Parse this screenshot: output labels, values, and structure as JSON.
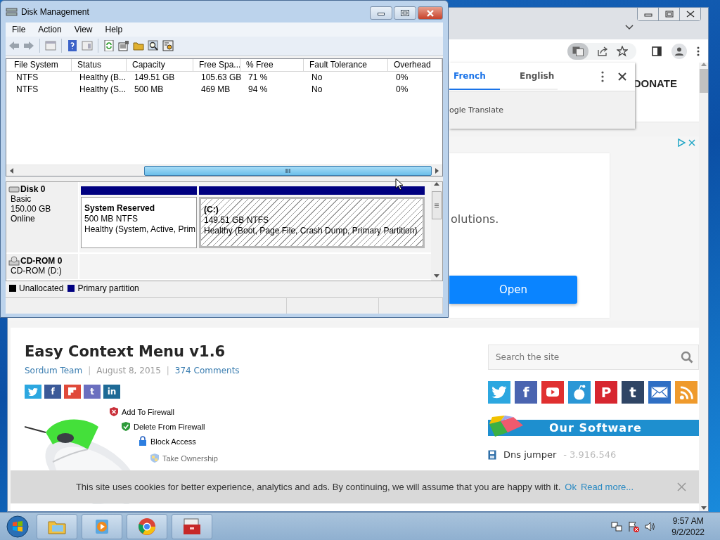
{
  "disk_management": {
    "title": "Disk Management",
    "menu": [
      "File",
      "Action",
      "View",
      "Help"
    ],
    "volume_columns": [
      "File System",
      "Status",
      "Capacity",
      "Free Spa...",
      "% Free",
      "Fault Tolerance",
      "Overhead"
    ],
    "volume_rows": [
      [
        "NTFS",
        "Healthy (B...",
        "149.51 GB",
        "105.63 GB",
        "71 %",
        "No",
        "0%"
      ],
      [
        "NTFS",
        "Healthy (S...",
        "500 MB",
        "469 MB",
        "94 %",
        "No",
        "0%"
      ]
    ],
    "disks": [
      {
        "kind": "disk",
        "name": "Disk 0",
        "info": [
          "Basic",
          "150.00 GB",
          "Online"
        ],
        "partitions": [
          {
            "name": "System Reserved",
            "size": "500 MB NTFS",
            "status": "Healthy (System, Active, Prim",
            "selected": false
          },
          {
            "name": "(C:)",
            "size": "149.51 GB NTFS",
            "status": "Healthy (Boot, Page File, Crash Dump, Primary Partition)",
            "selected": true
          }
        ]
      },
      {
        "kind": "cdrom",
        "name": "CD-ROM 0",
        "info": [
          "CD-ROM (D:)"
        ]
      }
    ],
    "legend": [
      {
        "label": "Unallocated",
        "color": "#000000"
      },
      {
        "label": "Primary partition",
        "color": "#000080"
      }
    ]
  },
  "browser": {
    "translate": {
      "tabs": [
        {
          "label": "French",
          "selected": true
        },
        {
          "label": "English",
          "selected": false
        }
      ],
      "footer": "ogle Translate"
    },
    "nav_link": "DONATE",
    "ad": {
      "text": "olutions.",
      "button": "Open"
    },
    "article": {
      "title": "Easy Context Menu v1.6",
      "meta": [
        {
          "kind": "link",
          "text": "Sordum Team"
        },
        {
          "kind": "sep",
          "text": "|"
        },
        {
          "kind": "plain",
          "text": "August 8, 2015"
        },
        {
          "kind": "sep",
          "text": "|"
        },
        {
          "kind": "link",
          "text": "374 Comments"
        }
      ],
      "share_buttons": [
        {
          "kind": "bird",
          "color": "#2ca7e0"
        },
        {
          "kind": "letter",
          "label": "f",
          "color": "#3b5998"
        },
        {
          "kind": "flip",
          "color": "#e0493a"
        },
        {
          "kind": "letter",
          "label": "t",
          "color": "#6b6fbf"
        },
        {
          "kind": "letter",
          "label": "in",
          "color": "#1e6a96"
        }
      ],
      "menu_items": [
        {
          "kind": "shield-x",
          "label": "Add To Firewall"
        },
        {
          "kind": "shield-check",
          "label": "Delete From Firewall"
        },
        {
          "kind": "lock",
          "label": "Block Access"
        },
        {
          "kind": "shield-color",
          "label": "Take Ownership"
        }
      ]
    },
    "sidebar": {
      "search_placeholder": "Search the site",
      "follow_buttons": [
        {
          "kind": "bird",
          "color": "#2ca7e0"
        },
        {
          "kind": "letter",
          "label": "f",
          "color": "#4a64b0"
        },
        {
          "kind": "play",
          "color": "#e02f2f"
        },
        {
          "kind": "alien",
          "color": "#2b97d6"
        },
        {
          "kind": "letter",
          "label": "P",
          "color": "#d7262f"
        },
        {
          "kind": "letter",
          "label": "t",
          "color": "#2f4565"
        },
        {
          "kind": "envelope",
          "color": "#2f6fc4"
        },
        {
          "kind": "rss",
          "color": "#ef9a2c"
        }
      ],
      "heading": "Our Software",
      "software": [
        {
          "name": "Dns jumper",
          "count": "- 3.916.546"
        }
      ]
    },
    "cookie_banner": {
      "text": "This site uses cookies for better experience, analytics and ads. By continuing, we will assume that you are happy with it.",
      "ok": "Ok",
      "more": "Read more..."
    }
  },
  "taskbar": {
    "time": "9:57 AM",
    "date": "9/2/2022"
  }
}
